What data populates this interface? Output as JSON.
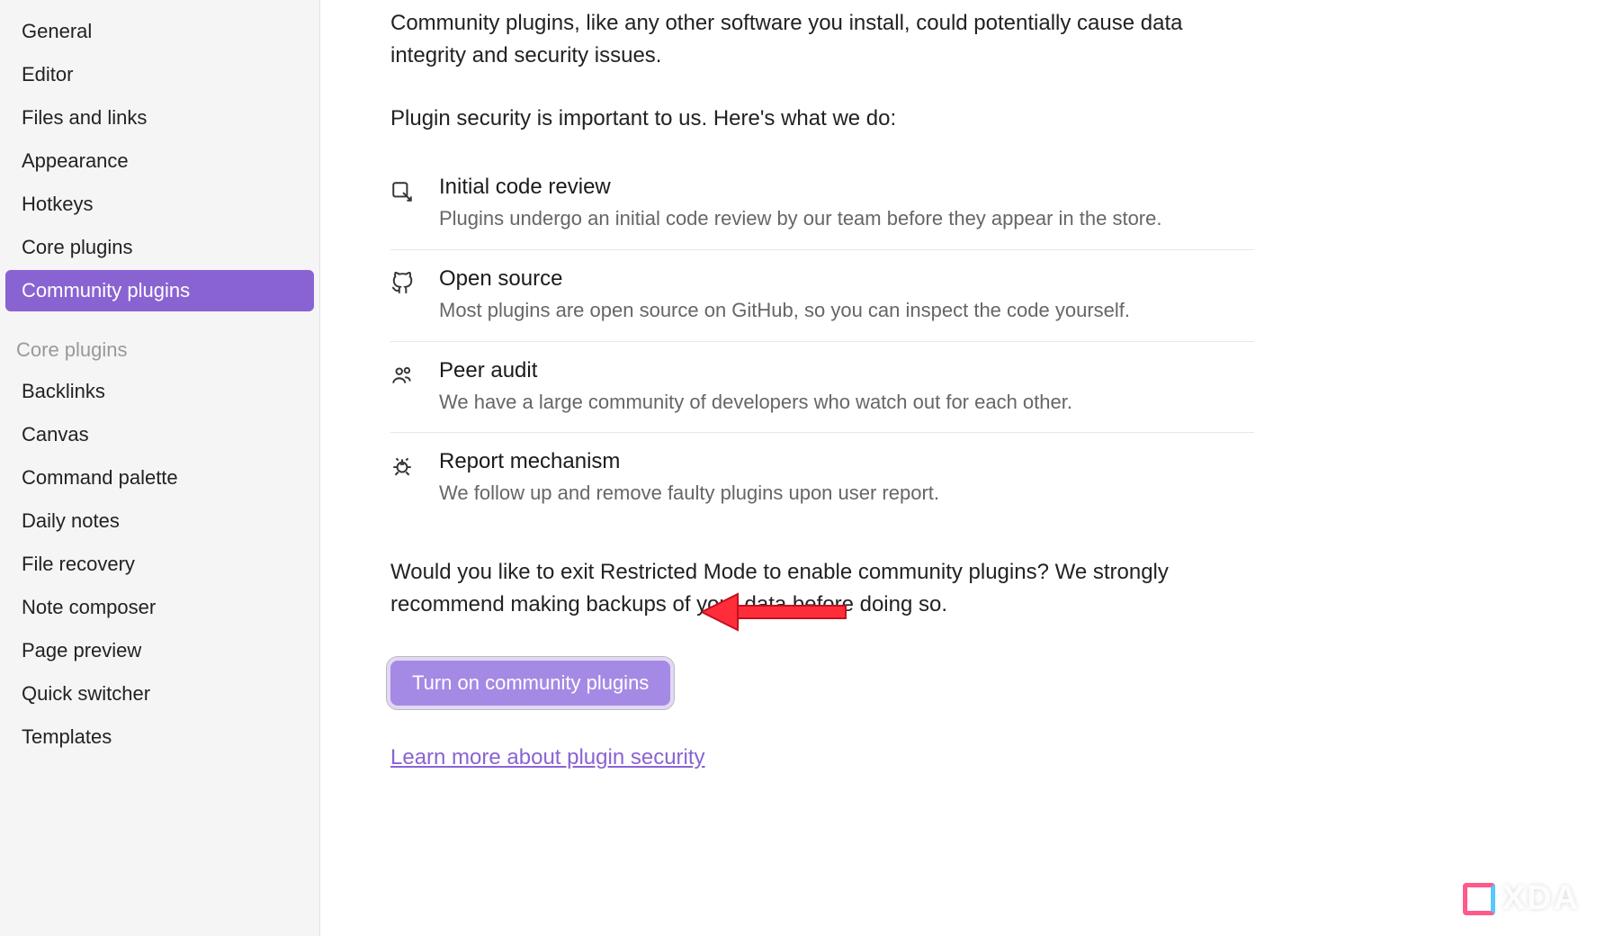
{
  "sidebar": {
    "main_items": [
      {
        "label": "General"
      },
      {
        "label": "Editor"
      },
      {
        "label": "Files and links"
      },
      {
        "label": "Appearance"
      },
      {
        "label": "Hotkeys"
      },
      {
        "label": "Core plugins"
      },
      {
        "label": "Community plugins",
        "active": true
      }
    ],
    "section_header": "Core plugins",
    "core_items": [
      {
        "label": "Backlinks"
      },
      {
        "label": "Canvas"
      },
      {
        "label": "Command palette"
      },
      {
        "label": "Daily notes"
      },
      {
        "label": "File recovery"
      },
      {
        "label": "Note composer"
      },
      {
        "label": "Page preview"
      },
      {
        "label": "Quick switcher"
      },
      {
        "label": "Templates"
      }
    ]
  },
  "content": {
    "intro": "Community plugins, like any other software you install, could potentially cause data integrity and security issues.",
    "security_intro": "Plugin security is important to us. Here's what we do:",
    "features": [
      {
        "title": "Initial code review",
        "desc": "Plugins undergo an initial code review by our team before they appear in the store."
      },
      {
        "title": "Open source",
        "desc": "Most plugins are open source on GitHub, so you can inspect the code yourself."
      },
      {
        "title": "Peer audit",
        "desc": "We have a large community of developers who watch out for each other."
      },
      {
        "title": "Report mechanism",
        "desc": "We follow up and remove faulty plugins upon user report."
      }
    ],
    "prompt": "Would you like to exit Restricted Mode to enable community plugins? We strongly recommend making backups of your data before doing so.",
    "button_label": "Turn on community plugins",
    "link_label": "Learn more about plugin security"
  },
  "watermark": "XDA",
  "colors": {
    "accent": "#8a63d2"
  }
}
